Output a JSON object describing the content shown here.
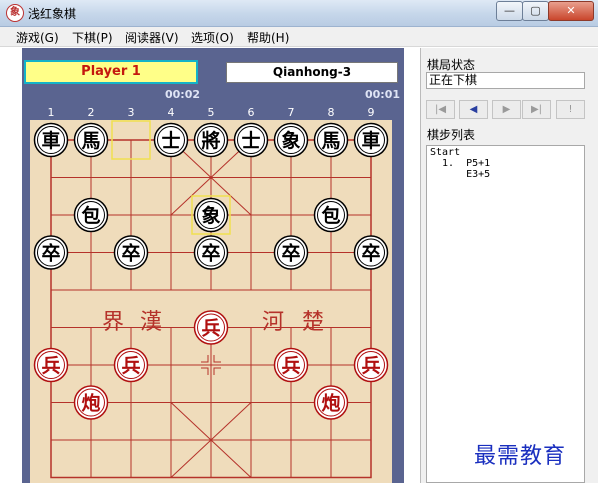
{
  "window": {
    "title": "浅红象棋",
    "app_icon_glyph": "象",
    "min_glyph": "—",
    "max_glyph": "▢",
    "close_glyph": "✕"
  },
  "menu": [
    {
      "label": "游戏(G)"
    },
    {
      "label": "下棋(P)"
    },
    {
      "label": "阅读器(V)"
    },
    {
      "label": "选项(O)"
    },
    {
      "label": "帮助(H)"
    }
  ],
  "players": {
    "player1": {
      "name": "Player 1",
      "timer": "00:02"
    },
    "player2": {
      "name": "Qianhong-3",
      "timer": "00:01"
    }
  },
  "board": {
    "column_numbers": [
      "1",
      "2",
      "3",
      "4",
      "5",
      "6",
      "7",
      "8",
      "9"
    ],
    "river_text": {
      "left": [
        "界",
        "漢"
      ],
      "right": [
        "河",
        "楚"
      ]
    },
    "colors": {
      "black_piece": "#000000",
      "red_piece": "#b01010",
      "highlight": "#f0e050",
      "grid": "#b5322a"
    },
    "pieces": [
      {
        "side": "black",
        "char": "車",
        "file": 0,
        "rank": 0
      },
      {
        "side": "black",
        "char": "馬",
        "file": 1,
        "rank": 0
      },
      {
        "side": "black",
        "char": "士",
        "file": 3,
        "rank": 0
      },
      {
        "side": "black",
        "char": "將",
        "file": 4,
        "rank": 0
      },
      {
        "side": "black",
        "char": "士",
        "file": 5,
        "rank": 0
      },
      {
        "side": "black",
        "char": "象",
        "file": 6,
        "rank": 0
      },
      {
        "side": "black",
        "char": "馬",
        "file": 7,
        "rank": 0
      },
      {
        "side": "black",
        "char": "車",
        "file": 8,
        "rank": 0
      },
      {
        "side": "black",
        "char": "包",
        "file": 1,
        "rank": 2
      },
      {
        "side": "black",
        "char": "象",
        "file": 4,
        "rank": 2
      },
      {
        "side": "black",
        "char": "包",
        "file": 7,
        "rank": 2
      },
      {
        "side": "black",
        "char": "卒",
        "file": 0,
        "rank": 3
      },
      {
        "side": "black",
        "char": "卒",
        "file": 2,
        "rank": 3
      },
      {
        "side": "black",
        "char": "卒",
        "file": 4,
        "rank": 3
      },
      {
        "side": "black",
        "char": "卒",
        "file": 6,
        "rank": 3
      },
      {
        "side": "black",
        "char": "卒",
        "file": 8,
        "rank": 3
      },
      {
        "side": "red",
        "char": "兵",
        "file": 4,
        "rank": 5
      },
      {
        "side": "red",
        "char": "兵",
        "file": 0,
        "rank": 6
      },
      {
        "side": "red",
        "char": "兵",
        "file": 2,
        "rank": 6
      },
      {
        "side": "red",
        "char": "兵",
        "file": 6,
        "rank": 6
      },
      {
        "side": "red",
        "char": "兵",
        "file": 8,
        "rank": 6
      },
      {
        "side": "red",
        "char": "炮",
        "file": 1,
        "rank": 7
      },
      {
        "side": "red",
        "char": "炮",
        "file": 7,
        "rank": 7
      }
    ],
    "last_move_from": {
      "file": 2,
      "rank": 0
    },
    "last_move_to": {
      "file": 4,
      "rank": 2
    }
  },
  "side": {
    "status_label": "棋局状态",
    "status_value": "正在下棋",
    "nav_buttons": [
      {
        "name": "first-move-button",
        "glyph": "|◀"
      },
      {
        "name": "prev-move-button",
        "glyph": "◀"
      },
      {
        "name": "next-move-button",
        "glyph": "▶"
      },
      {
        "name": "last-move-button",
        "glyph": "▶|"
      },
      {
        "name": "hint-button",
        "glyph": "!"
      }
    ],
    "moves_label": "棋步列表",
    "moves": [
      "Start",
      "  1.  P5+1",
      "      E3+5"
    ]
  },
  "watermark": "最需教育"
}
